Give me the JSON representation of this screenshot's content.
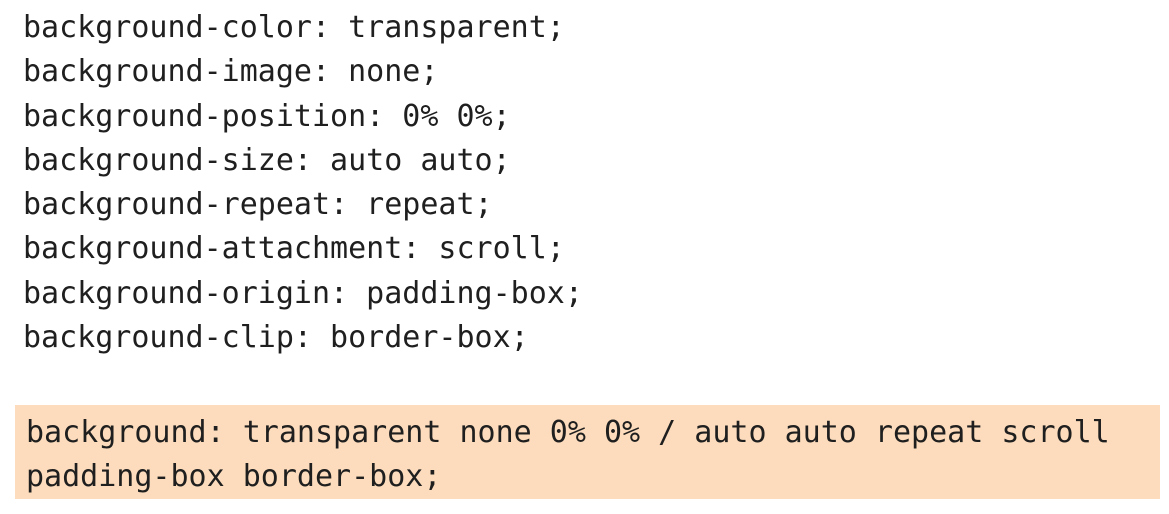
{
  "longhand_lines": [
    "background-color: transparent;",
    "background-image: none;",
    "background-position: 0% 0%;",
    "background-size: auto auto;",
    "background-repeat: repeat;",
    "background-attachment: scroll;",
    "background-origin: padding-box;",
    "background-clip: border-box;"
  ],
  "shorthand": {
    "line1": "background: transparent none 0% 0% / auto auto repeat scroll",
    "line2": "padding-box border-box;"
  },
  "colors": {
    "highlight_background": "#fcdcbc",
    "text": "#1f1f1f"
  }
}
